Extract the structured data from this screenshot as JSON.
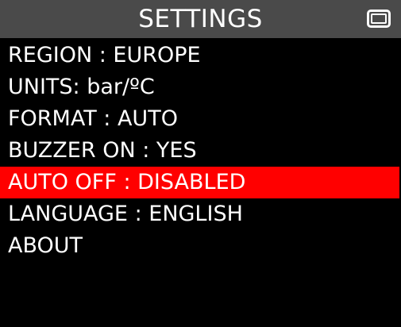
{
  "header": {
    "title": "SETTINGS",
    "battery_icon": "battery-icon"
  },
  "menu": {
    "items": [
      {
        "label": "REGION : EUROPE",
        "selected": false
      },
      {
        "label": "UNITS: bar/ºC",
        "selected": false
      },
      {
        "label": "FORMAT : AUTO",
        "selected": false
      },
      {
        "label": "BUZZER ON : YES",
        "selected": false
      },
      {
        "label": "AUTO OFF : DISABLED",
        "selected": true
      },
      {
        "label": "LANGUAGE : ENGLISH",
        "selected": false
      },
      {
        "label": "ABOUT",
        "selected": false
      }
    ]
  },
  "colors": {
    "background": "#000000",
    "header_background": "#4a4a4a",
    "selection": "#ff0000",
    "text": "#ffffff"
  }
}
